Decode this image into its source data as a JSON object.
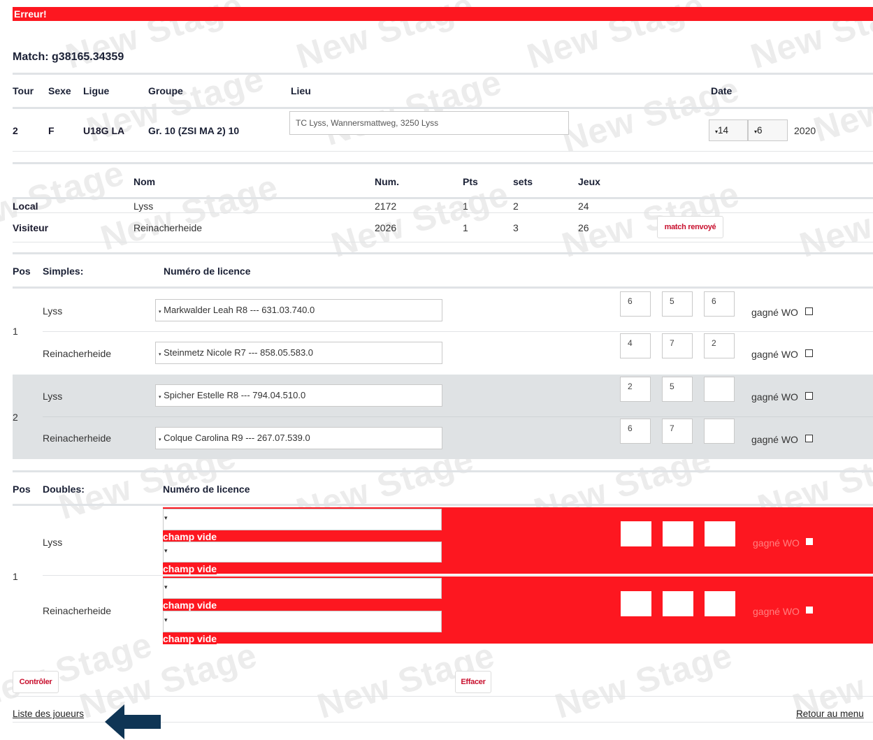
{
  "error_banner": "Erreur!",
  "match": {
    "label": "Match:",
    "id": "g38165.34359"
  },
  "match_info": {
    "headers": {
      "tour": "Tour",
      "sexe": "Sexe",
      "ligue": "Ligue",
      "groupe": "Groupe",
      "lieu": "Lieu",
      "date": "Date"
    },
    "values": {
      "tour": "2",
      "sexe": "F",
      "ligue": "U18G LA",
      "groupe": "Gr. 10 (ZSI MA 2) 10",
      "lieu": "TC Lyss, Wannersmattweg, 3250 Lyss",
      "day": "14",
      "month": "6",
      "year": "2020"
    }
  },
  "teams": {
    "headers": {
      "nom": "Nom",
      "num": "Num.",
      "pts": "Pts",
      "sets": "sets",
      "jeux": "Jeux"
    },
    "rows": [
      {
        "role": "Local",
        "name": "Lyss",
        "num": "2172",
        "pts": "1",
        "sets": "2",
        "jeux": "24"
      },
      {
        "role": "Visiteur",
        "name": "Reinacherheide",
        "num": "2026",
        "pts": "1",
        "sets": "3",
        "jeux": "26"
      }
    ],
    "postponed_button": "match renvoyé"
  },
  "singles": {
    "headers": {
      "pos": "Pos",
      "title": "Simples:",
      "licence": "Numéro de licence"
    },
    "matches": [
      {
        "pos": "1",
        "players": [
          {
            "team": "Lyss",
            "player": "Markwalder Leah R8 --- 631.03.740.0",
            "scores": [
              "6",
              "5",
              "6"
            ],
            "wo_label": "gagné WO"
          },
          {
            "team": "Reinacherheide",
            "player": "Steinmetz Nicole R7 --- 858.05.583.0",
            "scores": [
              "4",
              "7",
              "2"
            ],
            "wo_label": "gagné WO"
          }
        ]
      },
      {
        "pos": "2",
        "players": [
          {
            "team": "Lyss",
            "player": "Spicher Estelle R8 --- 794.04.510.0",
            "scores": [
              "2",
              "5",
              ""
            ],
            "wo_label": "gagné WO"
          },
          {
            "team": "Reinacherheide",
            "player": "Colque Carolina R9 --- 267.07.539.0",
            "scores": [
              "6",
              "7",
              ""
            ],
            "wo_label": "gagné WO"
          }
        ]
      }
    ]
  },
  "doubles": {
    "headers": {
      "pos": "Pos",
      "title": "Doubles:",
      "licence": "Numéro de licence"
    },
    "matches": [
      {
        "pos": "1",
        "teams": [
          {
            "team": "Lyss",
            "wo_label": "gagné WO",
            "errors": [
              "champ vide",
              "champ vide"
            ]
          },
          {
            "team": "Reinacherheide",
            "wo_label": "gagné WO",
            "errors": [
              "champ vide",
              "champ vide"
            ]
          }
        ]
      }
    ]
  },
  "actions": {
    "check": "Contrôler",
    "clear": "Effacer"
  },
  "footer": {
    "players_list": "Liste des joueurs",
    "back_to_menu": "Retour au menu"
  },
  "watermark": "New Stage",
  "colors": {
    "error_red": "#fd1720",
    "header_navy": "#1a2035",
    "arrow_navy": "#0f3555",
    "row_alt_gray": "#dfe2e4"
  }
}
